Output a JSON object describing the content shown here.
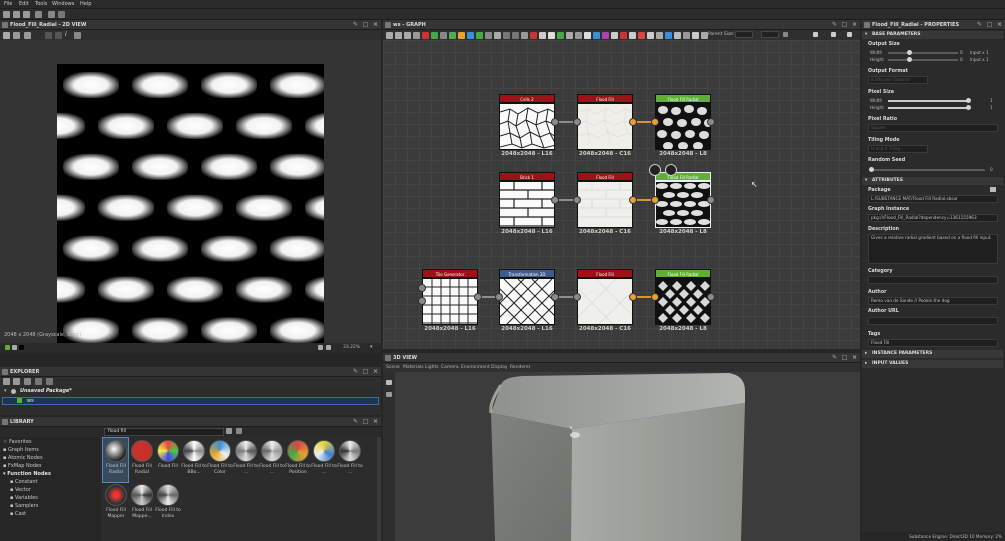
{
  "menu": [
    "File",
    "Edit",
    "Tools",
    "Windows",
    "Help"
  ],
  "view2d": {
    "title": "Flood_Fill_Radial - 2D VIEW",
    "status": "2048 x 2048 (Grayscale, 8bpc)",
    "zoom": "33.22%"
  },
  "graph": {
    "title": "ws - GRAPH",
    "parent_size_label": "Parent Size:",
    "nodes": [
      {
        "id": "cells",
        "label": "Cells 2",
        "res": "2048x2048 - L16",
        "color": "#9b1316"
      },
      {
        "id": "ff1",
        "label": "Flood Fill",
        "res": "2048x2048 - C16",
        "color": "#9b1316"
      },
      {
        "id": "ffr1",
        "label": "Flood Fill Radial",
        "res": "2048x2048 - L8",
        "color": "#5fae3a"
      },
      {
        "id": "brick",
        "label": "Brick 1",
        "res": "2048x2048 - L16",
        "color": "#9b1316"
      },
      {
        "id": "ff2",
        "label": "Flood Fill",
        "res": "2048x2048 - C16",
        "color": "#9b1316"
      },
      {
        "id": "ffr2",
        "label": "Flood Fill Radial",
        "res": "2048x2048 - L8",
        "color": "#5fae3a"
      },
      {
        "id": "tile",
        "label": "Tile Generator",
        "res": "2048x2048 - L16",
        "color": "#9b1316"
      },
      {
        "id": "transform",
        "label": "Transformation 2D",
        "res": "2048x2048 - L16",
        "color": "#3d5b8f"
      },
      {
        "id": "ff3",
        "label": "Flood Fill",
        "res": "2048x2048 - C16",
        "color": "#9b1316"
      },
      {
        "id": "ffr3",
        "label": "Flood Fill Radial",
        "res": "2048x2048 - L8",
        "color": "#5fae3a"
      }
    ]
  },
  "explorer": {
    "title": "EXPLORER",
    "package": "Unsaved Package*",
    "item": "ws"
  },
  "library": {
    "title": "LIBRARY",
    "search_value": "flood fill",
    "tree": [
      "Favorites",
      "Graph Items",
      "Atomic Nodes",
      "FxMap Nodes",
      "Function Nodes",
      "Constant",
      "Vector",
      "Variables",
      "Samplers",
      "Cast"
    ],
    "items": [
      {
        "label": "Flood Fill Radial",
        "ball": "radial-gradient(circle at 40% 40%,#fff,#222 70%)"
      },
      {
        "label": "Flood Fill Radial",
        "ball": "#c8302c"
      },
      {
        "label": "Flood Fill",
        "ball": "conic-gradient(#e44,#4c4,#44e,#ee4,#e44)"
      },
      {
        "label": "Flood Fill to BBo...",
        "ball": "conic-gradient(#fff,#888,#fff,#444,#fff)"
      },
      {
        "label": "Flood Fill to Color",
        "ball": "conic-gradient(#3a8fd8,#eee,#e6a72a,#3a8fd8)"
      },
      {
        "label": "Flood Fill to ...",
        "ball": "conic-gradient(#eee,#555,#ddd,#777,#eee)"
      },
      {
        "label": "Flood Fill to ...",
        "ball": "conic-gradient(#eee,#999,#ddd,#666,#eee)"
      },
      {
        "label": "Flood Fill to Position",
        "ball": "conic-gradient(#d44,#e8a030,#4a4,#d44)"
      },
      {
        "label": "Flood Fill to ...",
        "ball": "conic-gradient(#e8d23a,#3a7fd8,#eee,#e8d23a)"
      },
      {
        "label": "Flood Fill to ...",
        "ball": "conic-gradient(#eee,#777,#ddd,#333,#eee)"
      },
      {
        "label": "Flood Fill Mapper",
        "ball": "radial-gradient(circle,#e33 20%,#333 60%)"
      },
      {
        "label": "Flood Fill Mappe...",
        "ball": "conic-gradient(#eee,#333,#ccc,#555,#eee)"
      },
      {
        "label": "Flood Fill to Index",
        "ball": "conic-gradient(#ddd,#666,#eee,#444,#ddd)"
      }
    ]
  },
  "view3d": {
    "title": "3D VIEW",
    "menu": [
      "Scene",
      "Materials",
      "Lights",
      "Camera",
      "Environment",
      "Display",
      "Renderer"
    ]
  },
  "properties": {
    "title": "Flood_Fill_Radial - PROPERTIES",
    "base_params": "BASE PARAMETERS",
    "output_size": "Output Size",
    "width": "Width",
    "height": "Height",
    "width_val": "0",
    "height_val": "0",
    "width_input": "Input x 1",
    "height_input": "Input x 1",
    "output_format": "Output Format",
    "output_format_val": "8 Bits per Channel",
    "pixel_size": "Pixel Size",
    "pixel_w": "1",
    "pixel_h": "1",
    "pixel_ratio": "Pixel Ratio",
    "pixel_ratio_val": "Square",
    "tiling_mode": "Tiling Mode",
    "tiling_mode_val": "H and V Tiling",
    "random_seed": "Random Seed",
    "random_seed_val": "0",
    "attributes": "ATTRIBUTES",
    "package": "Package",
    "package_val": "L:/SUBSTANCE MAT/Flood Fill Radial.sbsar",
    "graph_instance": "Graph Instance",
    "graph_instance_val": "pkg:///Flood_Fill_Radial?dependency=1361155963",
    "description": "Description",
    "description_val": "Gives a relative radial gradient based on a flood fill input.",
    "category": "Category",
    "author": "Author",
    "author_val": "Remo van de Sande // Pookie the dog",
    "author_url": "Author URL",
    "tags": "Tags",
    "tags_val": "Flood Fill",
    "instance_params": "INSTANCE PARAMETERS",
    "input_values": "INPUT VALUES"
  },
  "statusbar": "Substance Engine: Direct3D 10  Memory: 2%"
}
